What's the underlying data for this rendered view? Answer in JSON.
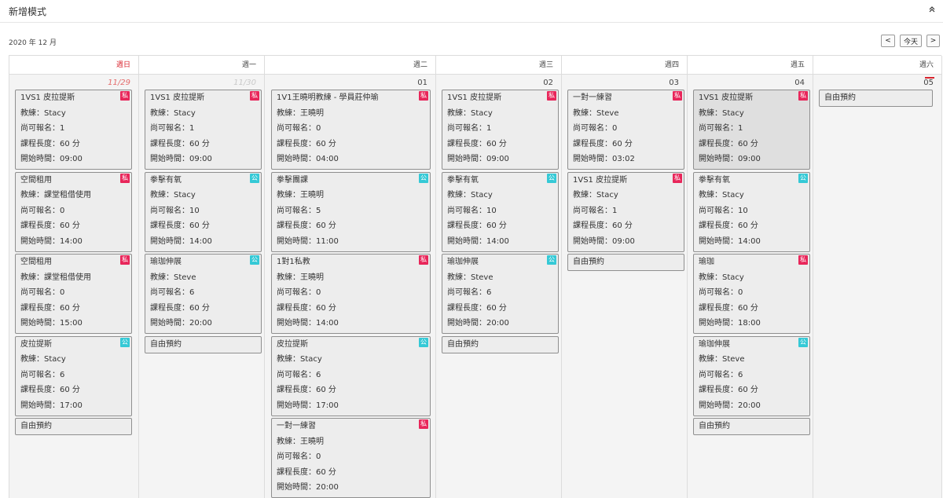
{
  "header": {
    "title": "新增模式"
  },
  "month_label": "2020 年 12 月",
  "nav": {
    "prev": "<",
    "today": "今天",
    "next": ">"
  },
  "labels": {
    "coach": "教練：",
    "remaining": "尚可報名：",
    "duration": "課程長度：",
    "duration_unit": " 分",
    "start": "開始時間：",
    "free_booking": "自由預約",
    "badge_private": "私",
    "badge_public": "公"
  },
  "weekdays": [
    "週日",
    "週一",
    "週二",
    "週三",
    "週四",
    "週五",
    "週六"
  ],
  "days": [
    {
      "date": "11/29",
      "courses": [
        {
          "name": "1VS1 皮拉提斯",
          "coach": "Stacy",
          "remaining": "1",
          "duration": "60",
          "start": "09:00",
          "type": "私"
        },
        {
          "name": "空間租用",
          "coach": "課堂租借使用",
          "remaining": "0",
          "duration": "60",
          "start": "14:00",
          "type": "私"
        },
        {
          "name": "空間租用",
          "coach": "課堂租借使用",
          "remaining": "0",
          "duration": "60",
          "start": "15:00",
          "type": "私"
        },
        {
          "name": "皮拉提斯",
          "coach": "Stacy",
          "remaining": "6",
          "duration": "60",
          "start": "17:00",
          "type": "公"
        }
      ]
    },
    {
      "date": "11/30",
      "courses": [
        {
          "name": "1VS1 皮拉提斯",
          "coach": "Stacy",
          "remaining": "1",
          "duration": "60",
          "start": "09:00",
          "type": "私"
        },
        {
          "name": "拳擊有氧",
          "coach": "Stacy",
          "remaining": "10",
          "duration": "60",
          "start": "14:00",
          "type": "公"
        },
        {
          "name": "瑜珈伸展",
          "coach": "Steve",
          "remaining": "6",
          "duration": "60",
          "start": "20:00",
          "type": "公"
        }
      ]
    },
    {
      "date": "01",
      "courses": [
        {
          "name": "1V1王曉明教練 - 學員莊仲瑜",
          "coach": "王曉明",
          "remaining": "0",
          "duration": "60",
          "start": "04:00",
          "type": "私"
        },
        {
          "name": "拳擊團課",
          "coach": "王曉明",
          "remaining": "5",
          "duration": "60",
          "start": "11:00",
          "type": "公"
        },
        {
          "name": "1對1私教",
          "coach": "王曉明",
          "remaining": "0",
          "duration": "60",
          "start": "14:00",
          "type": "私"
        },
        {
          "name": "皮拉提斯",
          "coach": "Stacy",
          "remaining": "6",
          "duration": "60",
          "start": "17:00",
          "type": "公"
        },
        {
          "name": "一對一練習",
          "coach": "王曉明",
          "remaining": "0",
          "duration": "60",
          "start": "20:00",
          "type": "私"
        }
      ]
    },
    {
      "date": "02",
      "courses": [
        {
          "name": "1VS1 皮拉提斯",
          "coach": "Stacy",
          "remaining": "1",
          "duration": "60",
          "start": "09:00",
          "type": "私"
        },
        {
          "name": "拳擊有氧",
          "coach": "Stacy",
          "remaining": "10",
          "duration": "60",
          "start": "14:00",
          "type": "公"
        },
        {
          "name": "瑜珈伸展",
          "coach": "Steve",
          "remaining": "6",
          "duration": "60",
          "start": "20:00",
          "type": "公"
        }
      ]
    },
    {
      "date": "03",
      "courses": [
        {
          "name": "一對一練習",
          "coach": "Steve",
          "remaining": "0",
          "duration": "60",
          "start": "03:02",
          "type": "私"
        },
        {
          "name": "1VS1 皮拉提斯",
          "coach": "Stacy",
          "remaining": "1",
          "duration": "60",
          "start": "09:00",
          "type": "私"
        }
      ]
    },
    {
      "date": "04",
      "courses": [
        {
          "name": "1VS1 皮拉提斯",
          "coach": "Stacy",
          "remaining": "1",
          "duration": "60",
          "start": "09:00",
          "type": "私"
        },
        {
          "name": "拳擊有氧",
          "coach": "Stacy",
          "remaining": "10",
          "duration": "60",
          "start": "14:00",
          "type": "公"
        },
        {
          "name": "瑜珈",
          "coach": "Stacy",
          "remaining": "0",
          "duration": "60",
          "start": "18:00",
          "type": "私"
        },
        {
          "name": "瑜珈伸展",
          "coach": "Steve",
          "remaining": "6",
          "duration": "60",
          "start": "20:00",
          "type": "公"
        }
      ]
    },
    {
      "date": "05",
      "courses": []
    }
  ]
}
